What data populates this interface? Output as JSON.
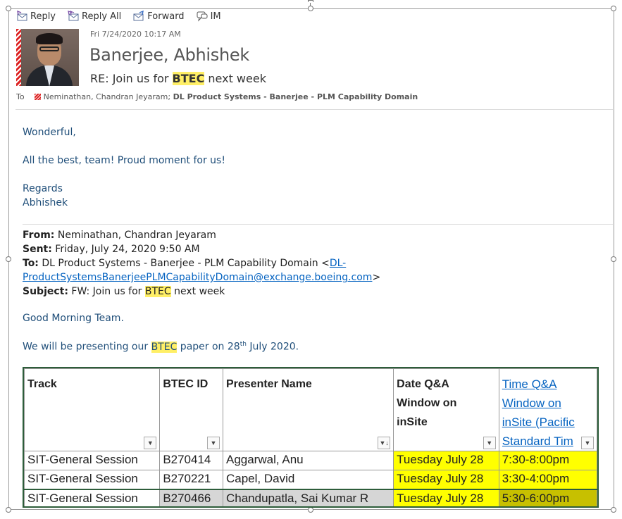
{
  "toolbar": {
    "reply": "Reply",
    "reply_all": "Reply All",
    "forward": "Forward",
    "im": "IM"
  },
  "header": {
    "date": "Fri 7/24/2020 10:17 AM",
    "sender": "Banerjee, Abhishek",
    "subject_prefix": "RE: Join us for ",
    "subject_highlight": "BTEC",
    "subject_suffix": " next week",
    "to_label": "To",
    "to_recipient": "Neminathan, Chandran Jeyaram;",
    "to_group": "DL Product Systems - Banerjee - PLM Capability Domain"
  },
  "reply": {
    "greeting": "Wonderful,",
    "message": "All the best, team! Proud moment for us!",
    "closing": "Regards",
    "signature": "Abhishek"
  },
  "forwarded": {
    "from_label": "From:",
    "from_value": " Neminathan, Chandran Jeyaram",
    "sent_label": "Sent:",
    "sent_value": " Friday, July 24, 2020 9:50 AM",
    "to_label": "To:",
    "to_value": " DL Product Systems - Banerjee - PLM Capability Domain <",
    "to_link_1": "DL-",
    "to_link_2": "ProductSystemsBanerjeePLMCapabilityDomain@exchange.boeing.com",
    "to_close": ">",
    "subject_label": "Subject:",
    "subject_prefix": " FW: Join us for ",
    "subject_highlight": "BTEC",
    "subject_suffix": " next week",
    "greeting": "Good Morning Team.",
    "line_prefix": "We will be presenting our ",
    "line_highlight": "BTEC",
    "line_mid": " paper on 28",
    "line_sup": "th",
    "line_suffix": " July 2020."
  },
  "table": {
    "headers": {
      "track": "Track",
      "btec_id": "BTEC ID",
      "presenter": "Presenter Name",
      "date_1": "Date Q&A",
      "date_2": "Window on",
      "date_3": "inSite",
      "time_1": "Time Q&A",
      "time_2": "Window on",
      "time_3": "inSite (Pacific",
      "time_4": "Standard Tim"
    },
    "rows": [
      {
        "track": "SIT-General Session",
        "btec_id": "B270414",
        "presenter": "Aggarwal, Anu",
        "date": "Tuesday July 28",
        "time": "7:30-8:00pm"
      },
      {
        "track": "SIT-General Session",
        "btec_id": "B270221",
        "presenter": "Capel, David",
        "date": "Tuesday July 28",
        "time": "3:30-4:00pm"
      },
      {
        "track": "SIT-General Session",
        "btec_id": "B270466",
        "presenter": "Chandupatla, Sai Kumar R",
        "date": "Tuesday July 28",
        "time": "5:30-6:00pm"
      }
    ]
  },
  "colors": {
    "body_text": "#1f4e79",
    "link": "#0563c1",
    "highlight": "#ffef66",
    "cell_yellow": "#ffff00"
  }
}
